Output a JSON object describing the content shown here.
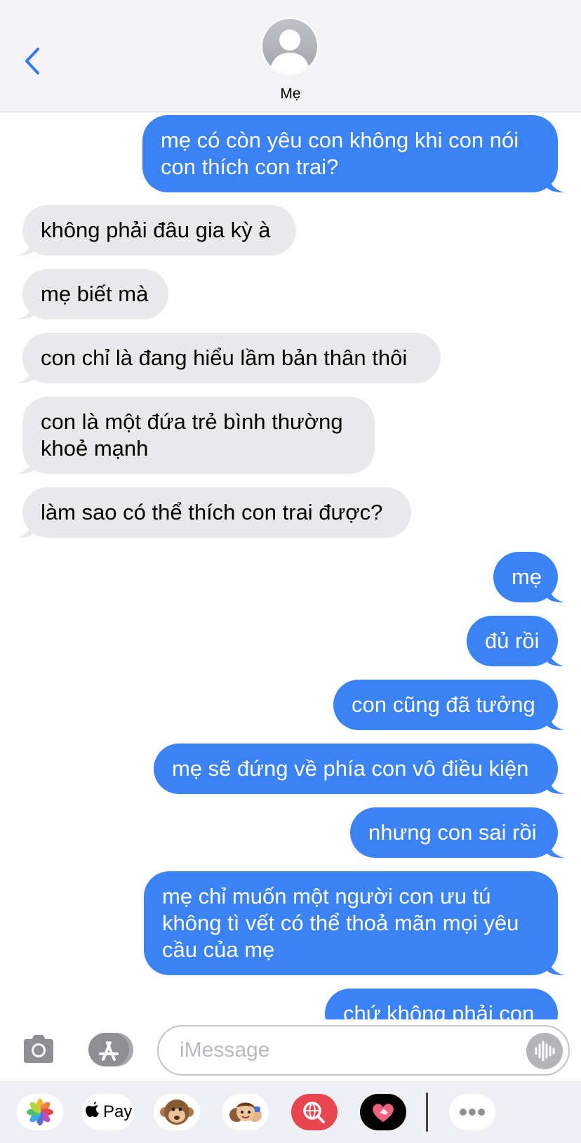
{
  "header": {
    "contact_name": "Mẹ"
  },
  "messages": [
    {
      "from": "me",
      "lines": [
        "mẹ có còn yêu con không khi con nói",
        "con thích con trai?"
      ]
    },
    {
      "from": "contact",
      "lines": [
        "không phải đâu gia kỳ à"
      ]
    },
    {
      "from": "contact",
      "lines": [
        "mẹ biết mà"
      ]
    },
    {
      "from": "contact",
      "lines": [
        "con chỉ là đang hiểu lầm bản thân thôi"
      ]
    },
    {
      "from": "contact",
      "lines": [
        "con là một đứa trẻ bình thường",
        "khoẻ mạnh"
      ]
    },
    {
      "from": "contact",
      "lines": [
        "làm sao có thể thích con trai được?"
      ]
    },
    {
      "from": "me",
      "lines": [
        "mẹ"
      ]
    },
    {
      "from": "me",
      "lines": [
        "đủ rồi"
      ]
    },
    {
      "from": "me",
      "lines": [
        "con cũng đã tưởng"
      ]
    },
    {
      "from": "me",
      "lines": [
        "mẹ sẽ đứng về phía con vô điều kiện"
      ]
    },
    {
      "from": "me",
      "lines": [
        "nhưng con sai rồi"
      ]
    },
    {
      "from": "me",
      "lines": [
        "mẹ chỉ muốn một người con ưu tú",
        "không tì vết có thể thoả mãn mọi yêu",
        "cầu của mẹ"
      ]
    },
    {
      "from": "me",
      "lines": [
        "chứ không phải con"
      ]
    }
  ],
  "input": {
    "placeholder": "iMessage"
  },
  "drawer": {
    "apple_pay_label": "Pay",
    "apps": [
      "photos-icon",
      "apple-pay-icon",
      "monkey-animoji-icon",
      "memoji-icon",
      "web-search-icon",
      "digital-touch-icon",
      "more-icon"
    ]
  },
  "colors": {
    "sent_bubble": "#3b82f5",
    "received_bubble": "#e9e9eb",
    "accent": "#3478f6"
  }
}
